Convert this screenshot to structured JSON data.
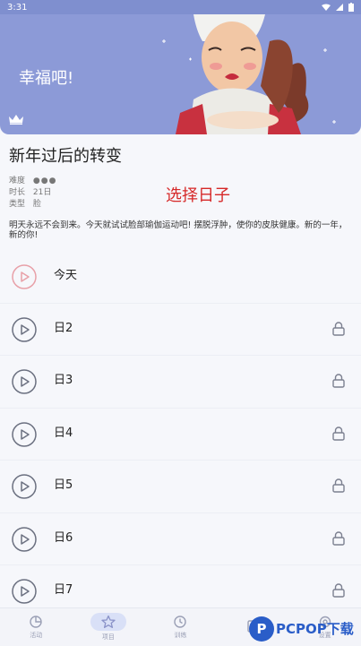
{
  "status": {
    "time": "3:31"
  },
  "hero": {
    "caption": "幸福吧!"
  },
  "program": {
    "title": "新年过后的转变",
    "meta": [
      {
        "key": "难度",
        "value": "●●●"
      },
      {
        "key": "时长",
        "value": "21日"
      },
      {
        "key": "类型",
        "value": "脸"
      }
    ],
    "callout": "选择日子",
    "description": "明天永远不会到来。今天就试试脸部瑜伽运动吧! 摆脱浮肿，使你的皮肤健康。新的一年，新的你!"
  },
  "days": [
    {
      "label": "今天",
      "locked": false,
      "accent": "#e8a0a8"
    },
    {
      "label": "日2",
      "locked": true,
      "accent": "#6b7080"
    },
    {
      "label": "日3",
      "locked": true,
      "accent": "#6b7080"
    },
    {
      "label": "日4",
      "locked": true,
      "accent": "#6b7080"
    },
    {
      "label": "日5",
      "locked": true,
      "accent": "#6b7080"
    },
    {
      "label": "日6",
      "locked": true,
      "accent": "#6b7080"
    },
    {
      "label": "日7",
      "locked": true,
      "accent": "#6b7080"
    }
  ],
  "nav": [
    {
      "label": "活动",
      "icon": "activity-icon"
    },
    {
      "label": "项目",
      "icon": "star-icon",
      "active": true
    },
    {
      "label": "训练",
      "icon": "clock-icon"
    },
    {
      "label": "",
      "icon": "page-icon"
    },
    {
      "label": "设置",
      "icon": "gear-icon"
    }
  ],
  "watermark": {
    "letter": "P",
    "text": "PCPOP下载"
  }
}
